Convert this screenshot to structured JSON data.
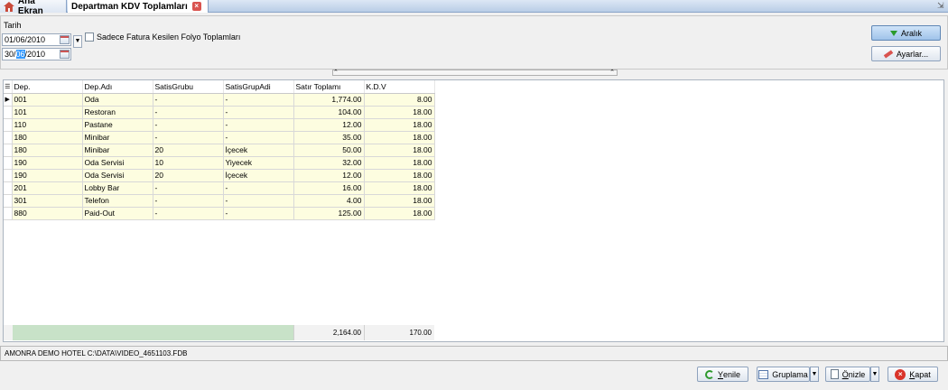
{
  "tabs": [
    {
      "label": "Ana Ekran"
    },
    {
      "label": "Departman KDV Toplamları"
    }
  ],
  "filter": {
    "date_label": "Tarih",
    "start_date": "01/06/2010",
    "end_date_prefix": "30/",
    "end_date_selected": "06",
    "end_date_suffix": "/2010",
    "checkbox_label": "Sadece Fatura Kesilen Folyo Toplamları",
    "checkbox_checked": false
  },
  "buttons": {
    "range": "Aralık",
    "settings": "Ayarlar...",
    "refresh_prefix": "Y",
    "refresh_rest": "enile",
    "group": "Gruplama",
    "preview_prefix": "Ö",
    "preview_rest": "nizle",
    "close_prefix": "K",
    "close_rest": "apat"
  },
  "grid": {
    "columns": [
      "Dep.",
      "Dep.Adı",
      "SatisGrubu",
      "SatisGrupAdi",
      "Satır Toplamı",
      "K.D.V"
    ],
    "rows": [
      {
        "dep": "001",
        "name": "Oda",
        "group": "-",
        "group_name": "-",
        "total": "1,774.00",
        "kdv": "8.00"
      },
      {
        "dep": "101",
        "name": "Restoran",
        "group": "-",
        "group_name": "-",
        "total": "104.00",
        "kdv": "18.00"
      },
      {
        "dep": "110",
        "name": "Pastane",
        "group": "-",
        "group_name": "-",
        "total": "12.00",
        "kdv": "18.00"
      },
      {
        "dep": "180",
        "name": "Minibar",
        "group": "-",
        "group_name": "-",
        "total": "35.00",
        "kdv": "18.00"
      },
      {
        "dep": "180",
        "name": "Minibar",
        "group": "20",
        "group_name": "İçecek",
        "total": "50.00",
        "kdv": "18.00"
      },
      {
        "dep": "190",
        "name": "Oda Servisi",
        "group": "10",
        "group_name": "Yiyecek",
        "total": "32.00",
        "kdv": "18.00"
      },
      {
        "dep": "190",
        "name": "Oda Servisi",
        "group": "20",
        "group_name": "İçecek",
        "total": "12.00",
        "kdv": "18.00"
      },
      {
        "dep": "201",
        "name": "Lobby Bar",
        "group": "-",
        "group_name": "-",
        "total": "16.00",
        "kdv": "18.00"
      },
      {
        "dep": "301",
        "name": "Telefon",
        "group": "-",
        "group_name": "-",
        "total": "4.00",
        "kdv": "18.00"
      },
      {
        "dep": "880",
        "name": "Paid-Out",
        "group": "-",
        "group_name": "-",
        "total": "125.00",
        "kdv": "18.00"
      }
    ],
    "footer_total": "2,164.00",
    "footer_kdv": "170.00"
  },
  "status": {
    "text": "AMONRA DEMO HOTEL C:\\DATA\\VIDEO_4651103.FDB"
  }
}
